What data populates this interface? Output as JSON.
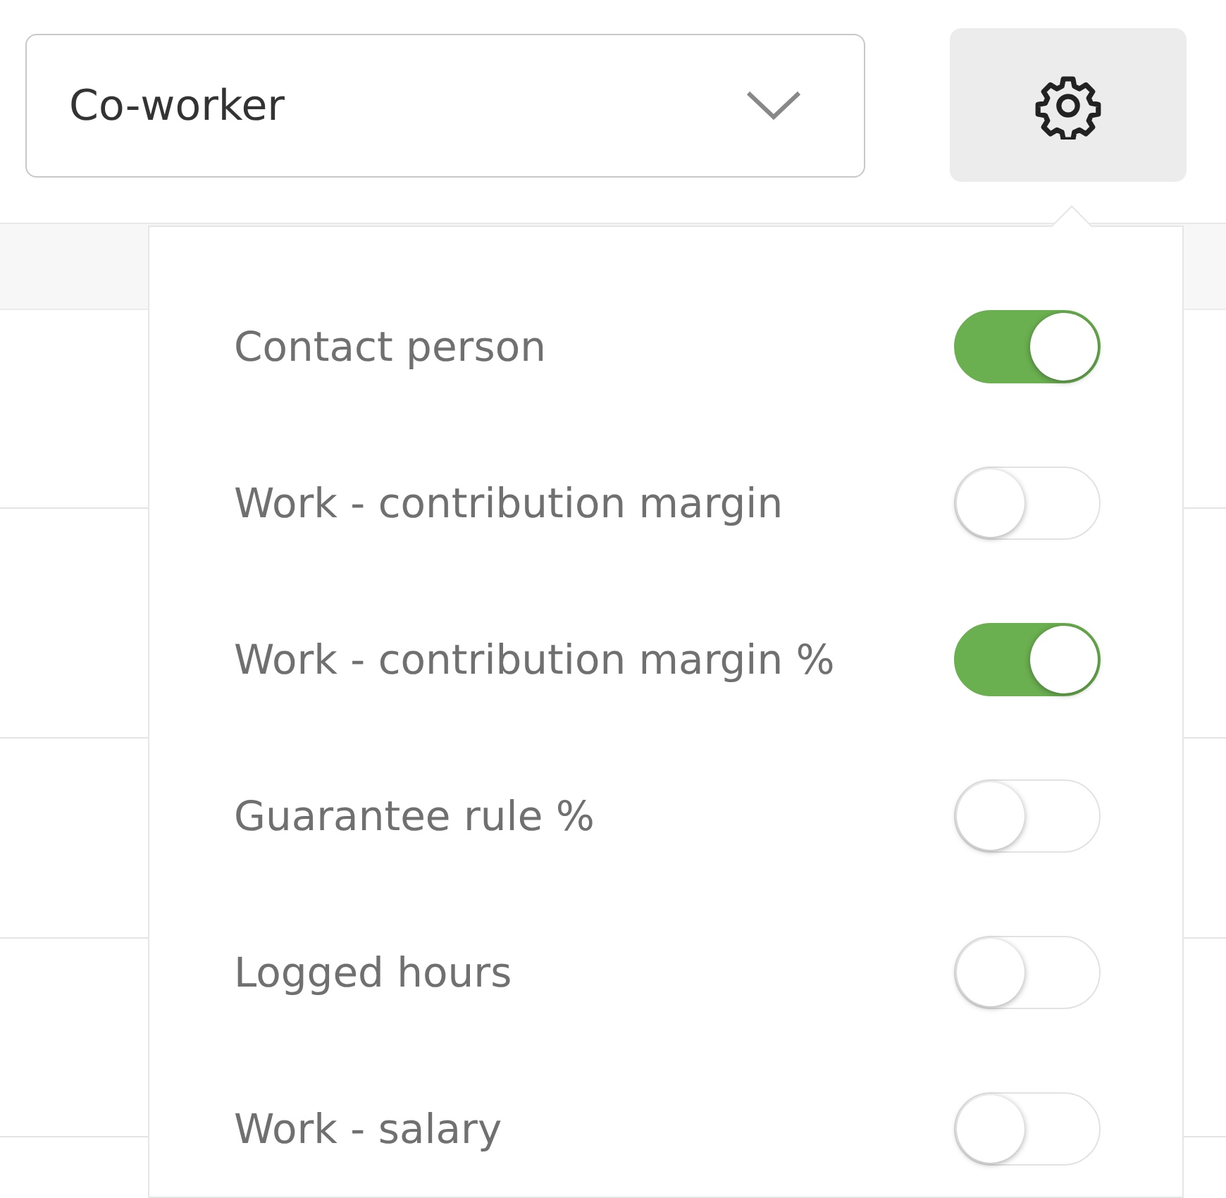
{
  "dropdown": {
    "value": "Co-worker"
  },
  "settings": [
    {
      "label": "Contact person",
      "on": true
    },
    {
      "label": "Work - contribution margin",
      "on": false
    },
    {
      "label": "Work - contribution margin %",
      "on": true
    },
    {
      "label": "Guarantee rule %",
      "on": false
    },
    {
      "label": "Logged hours",
      "on": false
    },
    {
      "label": "Work - salary",
      "on": false
    }
  ]
}
